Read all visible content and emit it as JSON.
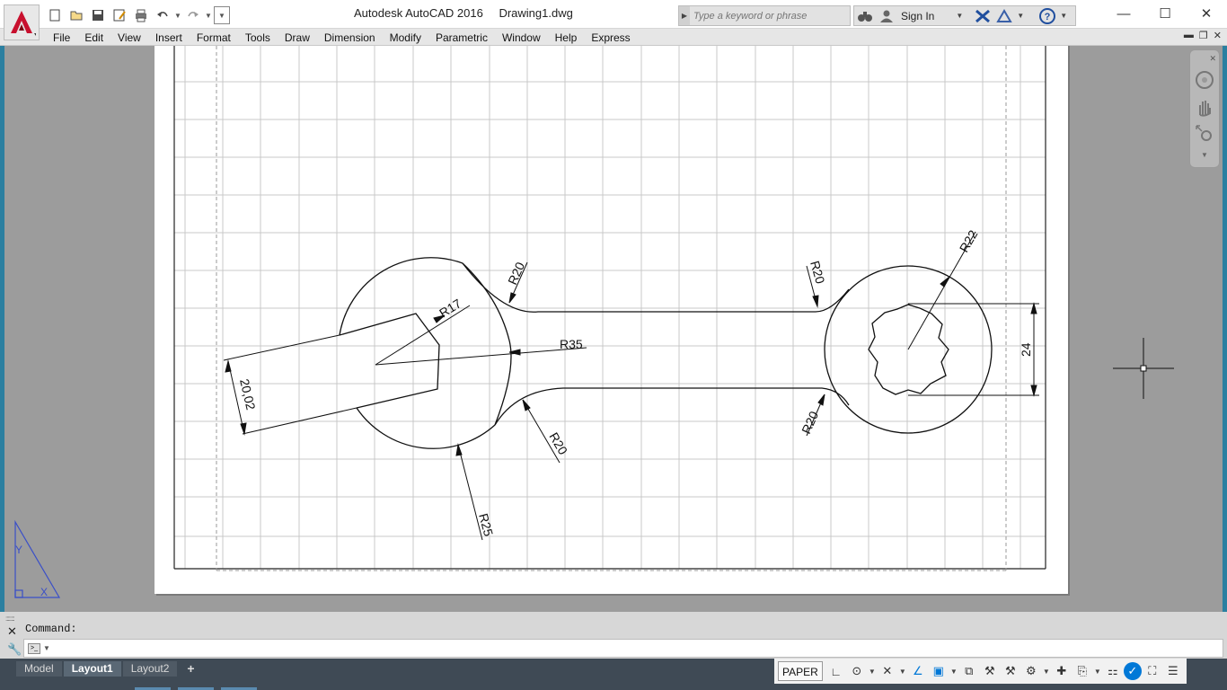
{
  "app": {
    "title": "Autodesk AutoCAD 2016",
    "document": "Drawing1.dwg",
    "search_placeholder": "Type a keyword or phrase",
    "sign_in": "Sign In"
  },
  "menu": [
    "File",
    "Edit",
    "View",
    "Insert",
    "Format",
    "Tools",
    "Draw",
    "Dimension",
    "Modify",
    "Parametric",
    "Window",
    "Help",
    "Express"
  ],
  "drawing": {
    "dimensions": {
      "r17": "R17",
      "r20_top_left": "R20",
      "r20_top_right": "R20",
      "r20_bottom_left": "R20",
      "r20_bottom_right": "R20",
      "r22": "R22",
      "r25": "R25",
      "r35": "R35",
      "d_20_02": "20,02",
      "d_24": "24"
    },
    "ucs_labels": {
      "y": "Y",
      "x": "X"
    }
  },
  "command": {
    "history": "Command:",
    "input": ""
  },
  "layouts": {
    "tabs": [
      "Model",
      "Layout1",
      "Layout2"
    ],
    "active": "Layout1",
    "add": "+"
  },
  "status": {
    "space": "PAPER"
  },
  "colors": {
    "accent": "#0078d7",
    "statusbar": "#3f4a55",
    "viewport_bg": "#9c9c9c",
    "logo_red": "#c8102e"
  }
}
